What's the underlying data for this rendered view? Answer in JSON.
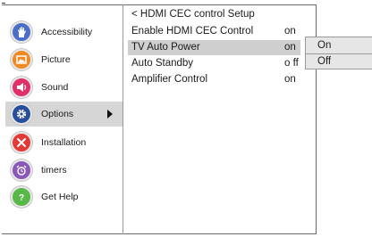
{
  "sidebar": {
    "items": [
      {
        "label": "Accessibility",
        "icon": "accessibility-hand-icon",
        "color": "#4a6fc8"
      },
      {
        "label": "Picture",
        "icon": "picture-icon",
        "color": "#f08a24"
      },
      {
        "label": "Sound",
        "icon": "speaker-icon",
        "color": "#e0306a"
      },
      {
        "label": "Options",
        "icon": "gear-icon",
        "color": "#2a4f9a",
        "selected": true
      },
      {
        "label": "Installation",
        "icon": "tools-icon",
        "color": "#e43a36"
      },
      {
        "label": "timers",
        "icon": "alarm-clock-icon",
        "color": "#8a58b8"
      },
      {
        "label": "Get Help",
        "icon": "help-icon",
        "color": "#58b848"
      }
    ]
  },
  "submenu": {
    "header": "< HDMI CEC control Setup",
    "rows": [
      {
        "label": "Enable HDMI CEC Control",
        "value": "on"
      },
      {
        "label": "TV Auto Power",
        "value": "on",
        "selected": true
      },
      {
        "label": "Auto Standby",
        "value": "o ff"
      },
      {
        "label": "Amplifier Control",
        "value": "on"
      }
    ]
  },
  "popup": {
    "options": [
      "On",
      "Off"
    ],
    "selected": "On"
  }
}
